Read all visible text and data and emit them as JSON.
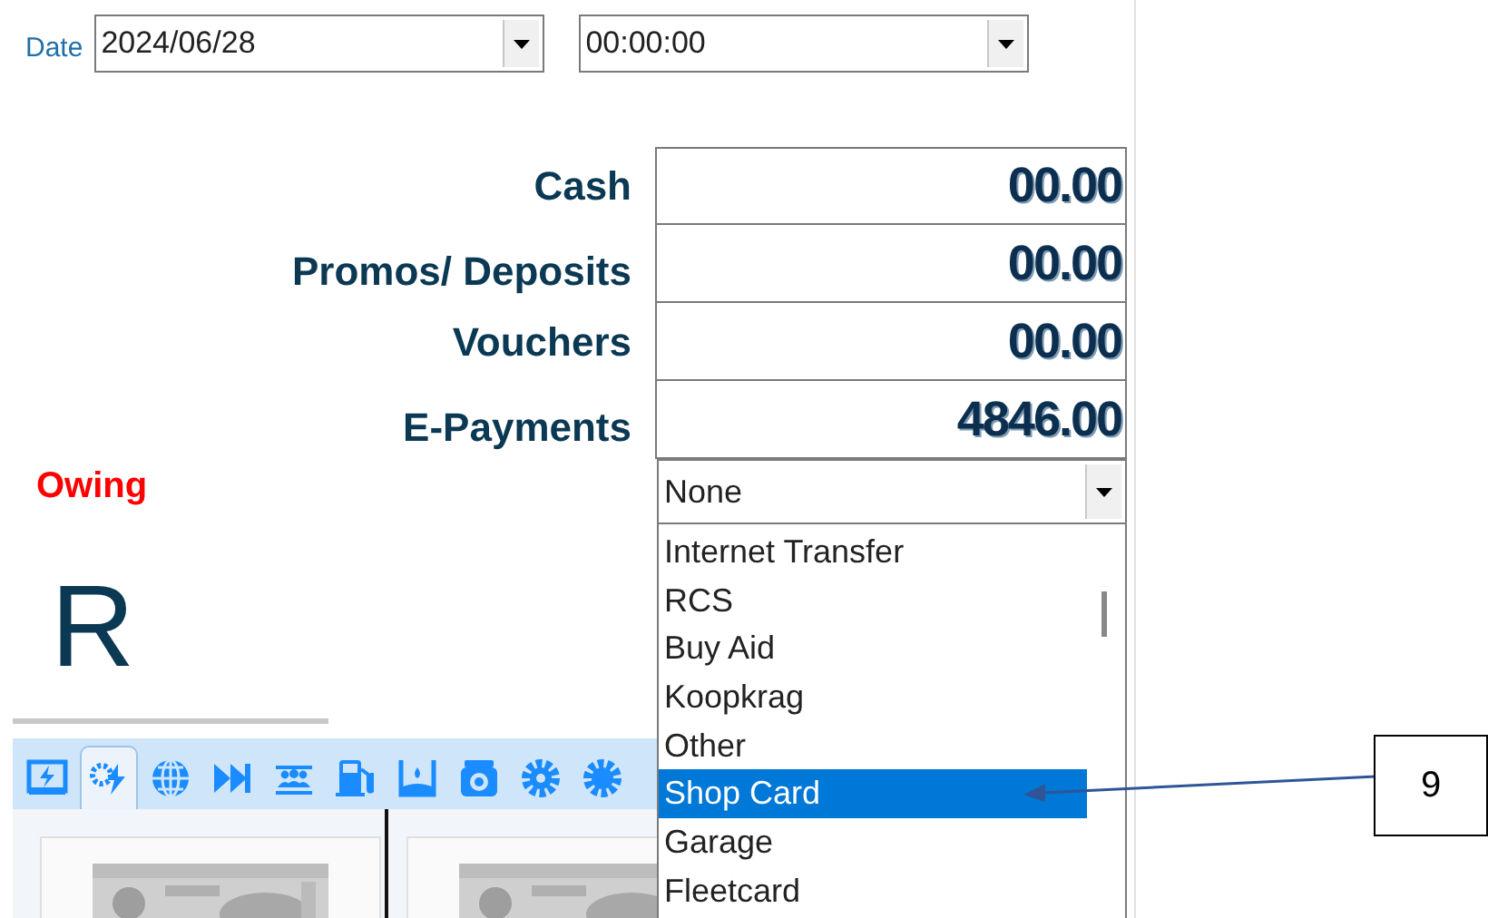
{
  "date_field": {
    "label": "Date",
    "value": "2024/06/28"
  },
  "time_field": {
    "value": "00:00:00"
  },
  "amounts": [
    {
      "label": "Cash",
      "value": "00.00"
    },
    {
      "label": "Promos/ Deposits",
      "value": "00.00"
    },
    {
      "label": "Vouchers",
      "value": "00.00"
    },
    {
      "label": "E-Payments",
      "value": "4846.00"
    }
  ],
  "owing": {
    "label": "Owing"
  },
  "payment_type": {
    "value": "None",
    "options": [
      {
        "label": "Internet Transfer",
        "selected": false
      },
      {
        "label": "RCS",
        "selected": false
      },
      {
        "label": "Buy Aid",
        "selected": false
      },
      {
        "label": "Koopkrag",
        "selected": false
      },
      {
        "label": "Other",
        "selected": false
      },
      {
        "label": "Shop Card",
        "selected": true
      },
      {
        "label": "Garage",
        "selected": false
      },
      {
        "label": "Fleetcard",
        "selected": false
      }
    ]
  },
  "currency_symbol": "R",
  "toolbar": {
    "tabs": [
      {
        "selected": false
      },
      {
        "selected": true
      },
      {
        "selected": false
      },
      {
        "selected": false
      },
      {
        "selected": false
      },
      {
        "selected": false
      },
      {
        "selected": false
      },
      {
        "selected": false
      },
      {
        "selected": false
      },
      {
        "selected": false
      }
    ]
  },
  "callout": {
    "label": "9"
  }
}
